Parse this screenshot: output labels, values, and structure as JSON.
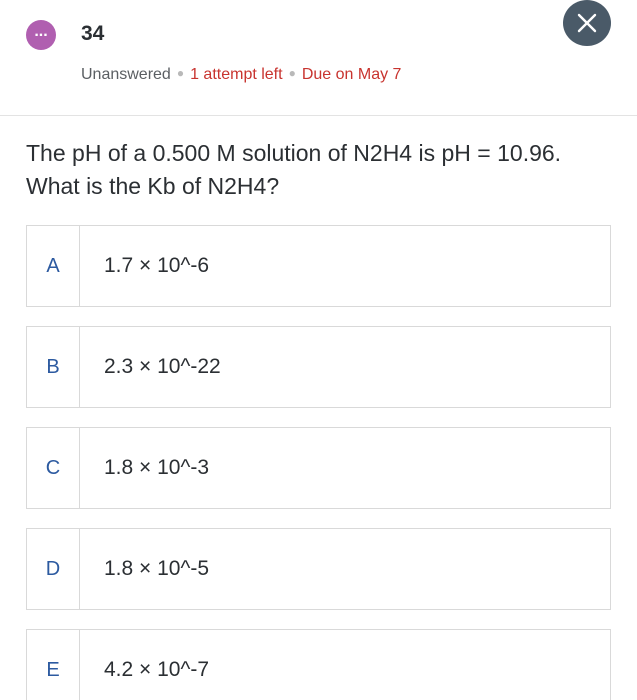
{
  "header": {
    "avatar_glyph": "...",
    "question_number": "34",
    "status": "Unanswered",
    "attempts": "1 attempt left",
    "due": "Due on May 7",
    "close_icon": "close-icon"
  },
  "question": {
    "line1": "The pH of a 0.500 M solution of N2H4 is pH = 10.96.",
    "line2": "What is the Kb of N2H4?"
  },
  "options": [
    {
      "letter": "A",
      "text": "1.7 × 10^-6"
    },
    {
      "letter": "B",
      "text": "2.3 × 10^-22"
    },
    {
      "letter": "C",
      "text": "1.8 × 10^-3"
    },
    {
      "letter": "D",
      "text": "1.8 × 10^-5"
    },
    {
      "letter": "E",
      "text": "4.2 × 10^-7"
    }
  ],
  "colors": {
    "avatar": "#b05fb0",
    "close_button": "#4a5a68",
    "accent_red": "#c8342f",
    "option_letter": "#2c5aa0"
  }
}
